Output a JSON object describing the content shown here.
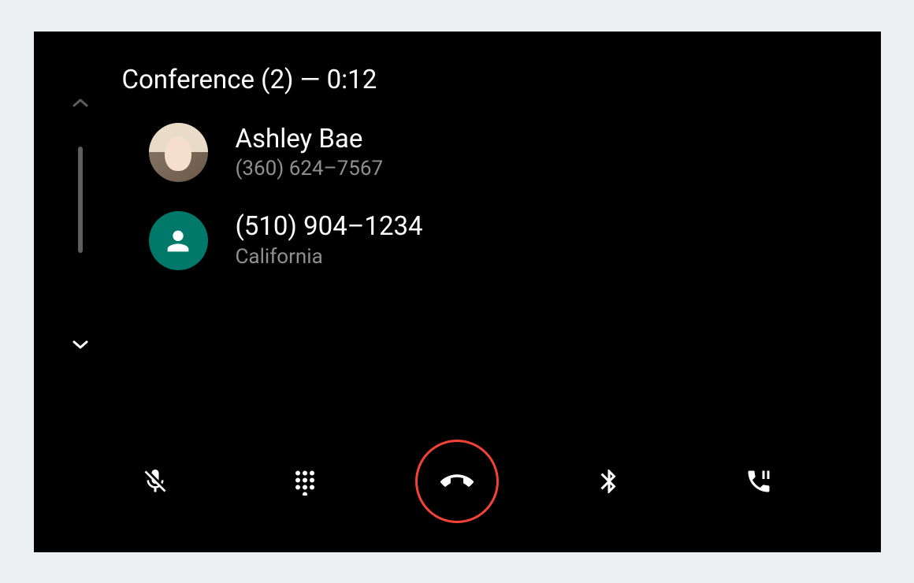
{
  "header": {
    "title": "Conference (2) — 0:12"
  },
  "participants": [
    {
      "name": "Ashley Bae",
      "detail": "(360) 624–7567",
      "avatar_type": "photo"
    },
    {
      "name": "(510) 904–1234",
      "detail": "California",
      "avatar_type": "generic"
    }
  ],
  "colors": {
    "hangup_border": "#f44336",
    "avatar_generic_bg": "#00796b"
  }
}
